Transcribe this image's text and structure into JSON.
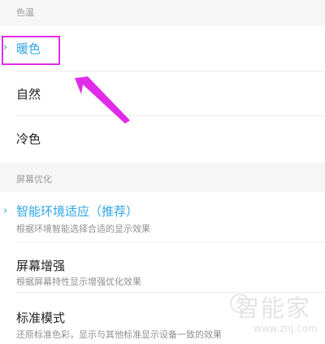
{
  "color_temperature": {
    "header": "色温",
    "options": {
      "warm": "暖色",
      "natural": "自然",
      "cool": "冷色"
    },
    "selected_indicator_icon": "chevron-right-icon",
    "selected": "暖色"
  },
  "screen_optimization": {
    "header": "屏幕优化",
    "items": [
      {
        "title": "智能环境适应（推荐）",
        "subtitle": "根据环境智能选择合适的显示效果",
        "selected": true
      },
      {
        "title": "屏幕增强",
        "subtitle": "根据屏幕特性显示增强优化效果",
        "selected": false
      },
      {
        "title": "标准模式",
        "subtitle": "还原标准色彩，显示与其他标准显示设备一致的效果",
        "selected": false
      }
    ]
  },
  "annotation": {
    "highlight_color": "#e02ce8",
    "arrow_color": "#e02ce8"
  },
  "watermark": {
    "text": "智能家",
    "url": "www.znj.com"
  },
  "colors": {
    "accent": "#2ea6e6",
    "section_bg": "#f6f6f6"
  }
}
